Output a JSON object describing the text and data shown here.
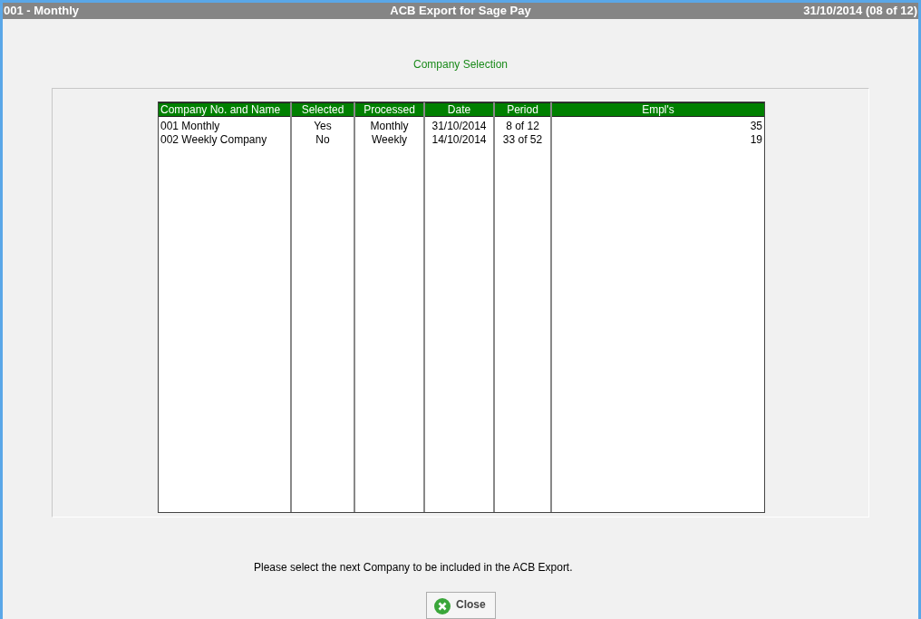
{
  "title_bar": {
    "left": "001 - Monthly",
    "center": "ACB Export for Sage Pay",
    "right": "31/10/2014 (08 of 12)"
  },
  "heading": "Company Selection",
  "table": {
    "columns": [
      "Company No. and Name",
      "Selected",
      "Processed",
      "Date",
      "Period",
      "Empl's"
    ],
    "rows": [
      [
        "001 Monthly",
        "Yes",
        "Monthly",
        "31/10/2014",
        "8 of 12",
        "35"
      ],
      [
        "002 Weekly Company",
        "No",
        "Weekly",
        "14/10/2014",
        "33 of 52",
        "19"
      ]
    ]
  },
  "message": "Please select the next Company to be included in the ACB Export.",
  "close_button": "Close"
}
